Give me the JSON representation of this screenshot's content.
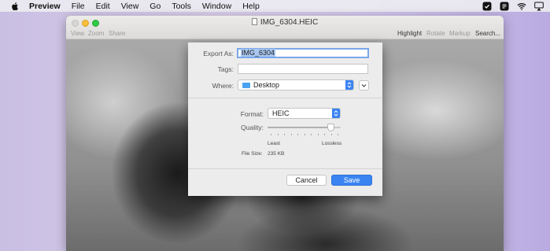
{
  "menubar": {
    "app": "Preview",
    "items": [
      "File",
      "Edit",
      "View",
      "Go",
      "Tools",
      "Window",
      "Help"
    ]
  },
  "window": {
    "title": "IMG_6304.HEIC",
    "toolbar_left": [
      "View",
      "Zoom",
      "Share"
    ],
    "toolbar_right": [
      "Highlight",
      "Rotate",
      "Markup",
      "Search..."
    ]
  },
  "export_sheet": {
    "export_as_label": "Export As:",
    "export_as_value": "IMG_6304",
    "tags_label": "Tags:",
    "tags_value": "",
    "where_label": "Where:",
    "where_value": "Desktop",
    "format_label": "Format:",
    "format_value": "HEIC",
    "quality_label": "Quality:",
    "quality_level": 0.9,
    "quality_min_label": "Least",
    "quality_max_label": "Lossless",
    "file_size_label": "File Size:",
    "file_size_value": "235 KB",
    "cancel_label": "Cancel",
    "save_label": "Save"
  },
  "colors": {
    "accent": "#3a84f2",
    "selection": "#a8c7f1",
    "focus_ring": "#7aa7ea"
  },
  "icons": [
    "apple-icon",
    "status-icon",
    "notes-icon",
    "wifi-icon",
    "airplay-icon",
    "folder-icon"
  ]
}
